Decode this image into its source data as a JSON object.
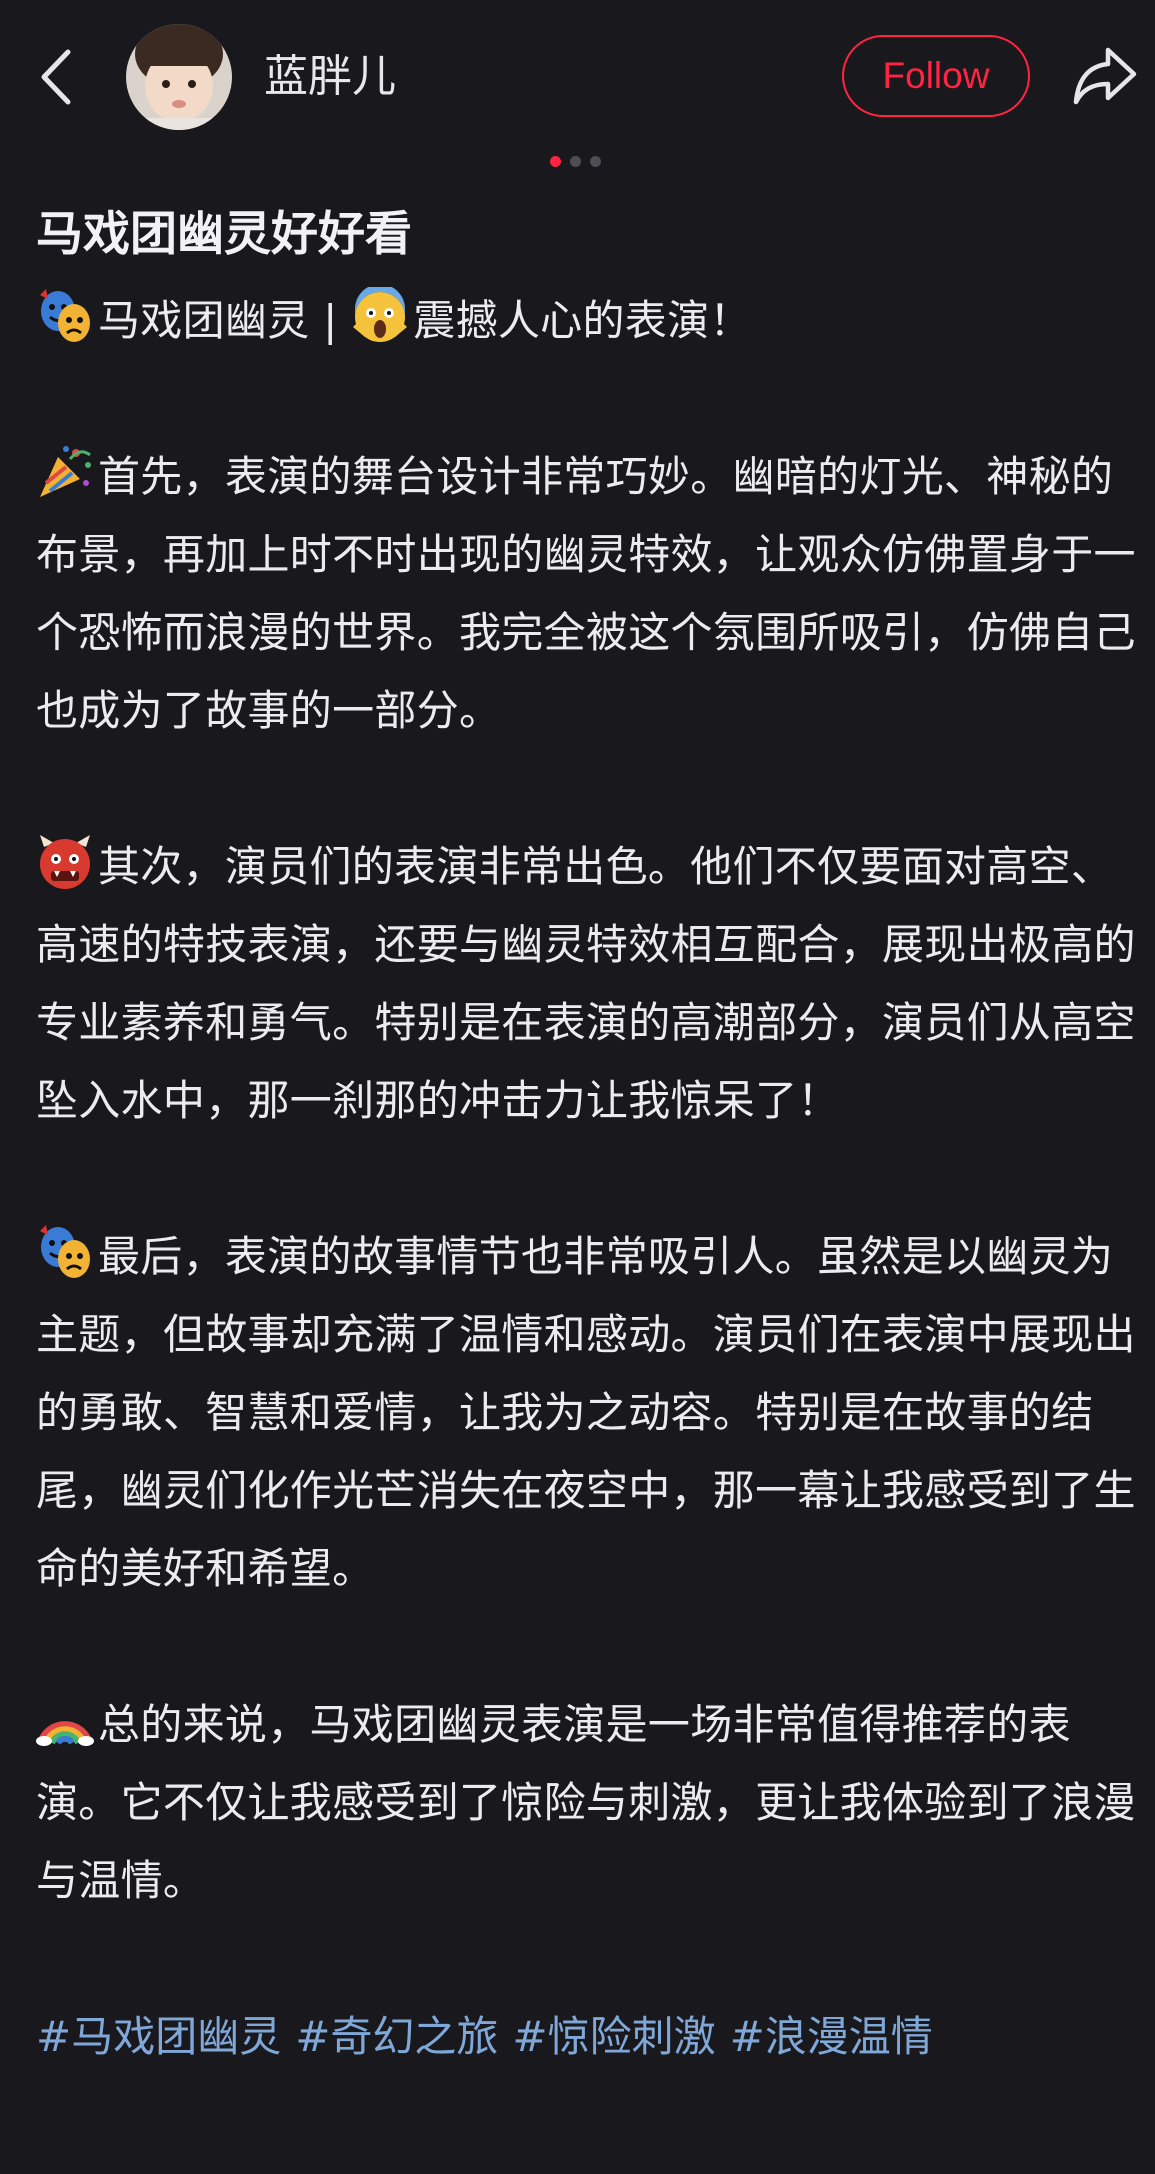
{
  "header": {
    "username": "蓝胖儿",
    "follow_label": "Follow"
  },
  "carousel": {
    "count": 3,
    "active": 1
  },
  "post": {
    "title": "马戏团幽灵好好看",
    "intro": {
      "emoji1": "performing-arts-emoji",
      "text1": "马戏团幽灵 | ",
      "emoji2": "screaming-face-emoji",
      "text2": "震撼人心的表演！"
    },
    "paragraphs": [
      {
        "emoji": "party-popper-emoji",
        "text": "首先，表演的舞台设计非常巧妙。幽暗的灯光、神秘的布景，再加上时不时出现的幽灵特效，让观众仿佛置身于一个恐怖而浪漫的世界。我完全被这个氛围所吸引，仿佛自己也成为了故事的一部分。"
      },
      {
        "emoji": "ogre-emoji",
        "text": "其次，演员们的表演非常出色。他们不仅要面对高空、高速的特技表演，还要与幽灵特效相互配合，展现出极高的专业素养和勇气。特别是在表演的高潮部分，演员们从高空坠入水中，那一刹那的冲击力让我惊呆了！"
      },
      {
        "emoji": "performing-arts-emoji",
        "text": "最后，表演的故事情节也非常吸引人。虽然是以幽灵为主题，但故事却充满了温情和感动。演员们在表演中展现出的勇敢、智慧和爱情，让我为之动容。特别是在故事的结尾，幽灵们化作光芒消失在夜空中，那一幕让我感受到了生命的美好和希望。"
      },
      {
        "emoji": "rainbow-emoji",
        "text": "总的来说，马戏团幽灵表演是一场非常值得推荐的表演。它不仅让我感受到了惊险与刺激，更让我体验到了浪漫与温情。"
      }
    ],
    "tags": [
      "#马戏团幽灵",
      "#奇幻之旅",
      "#惊险刺激",
      "#浪漫温情"
    ]
  },
  "colors": {
    "background": "#19181d",
    "accent": "#ff2442",
    "tag": "#7fa8d8",
    "text": "#ececee"
  }
}
